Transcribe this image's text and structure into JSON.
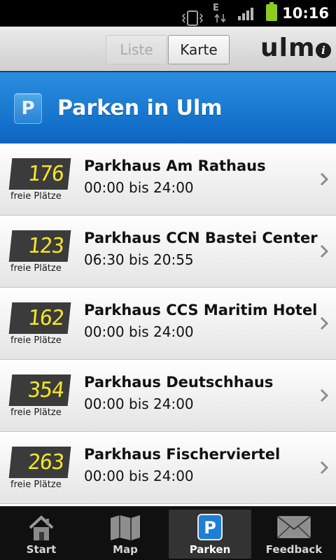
{
  "status_bar": {
    "time": "10:16",
    "network_label": "E",
    "battery_color": "#8acd1f"
  },
  "header": {
    "segments": [
      {
        "label": "Liste",
        "active": false
      },
      {
        "label": "Karte",
        "active": true
      }
    ],
    "logo_text": "ulm",
    "info_icon": "info-icon"
  },
  "title_bar": {
    "badge": "P",
    "title": "Parken in Ulm",
    "color": "#1a7ad4"
  },
  "parking": {
    "counter_label": "freie Plätze",
    "items": [
      {
        "free": "176",
        "name": "Parkhaus Am Rathaus",
        "hours": "00:00 bis 24:00"
      },
      {
        "free": "123",
        "name": "Parkhaus CCN Bastei Center",
        "hours": "06:30 bis 20:55"
      },
      {
        "free": "162",
        "name": "Parkhaus CCS Maritim Hotel",
        "hours": "00:00 bis 24:00"
      },
      {
        "free": "354",
        "name": "Parkhaus Deutschhaus",
        "hours": "00:00 bis 24:00"
      },
      {
        "free": "263",
        "name": "Parkhaus Fischerviertel",
        "hours": "00:00 bis 24:00"
      }
    ],
    "counter_color": "#f3e52a"
  },
  "tabbar": {
    "tabs": [
      {
        "label": "Start",
        "icon": "house-icon",
        "active": false
      },
      {
        "label": "Map",
        "icon": "map-icon",
        "active": false
      },
      {
        "label": "Parken",
        "icon": "parking-icon",
        "active": true
      },
      {
        "label": "Feedback",
        "icon": "envelope-icon",
        "active": false
      }
    ]
  }
}
